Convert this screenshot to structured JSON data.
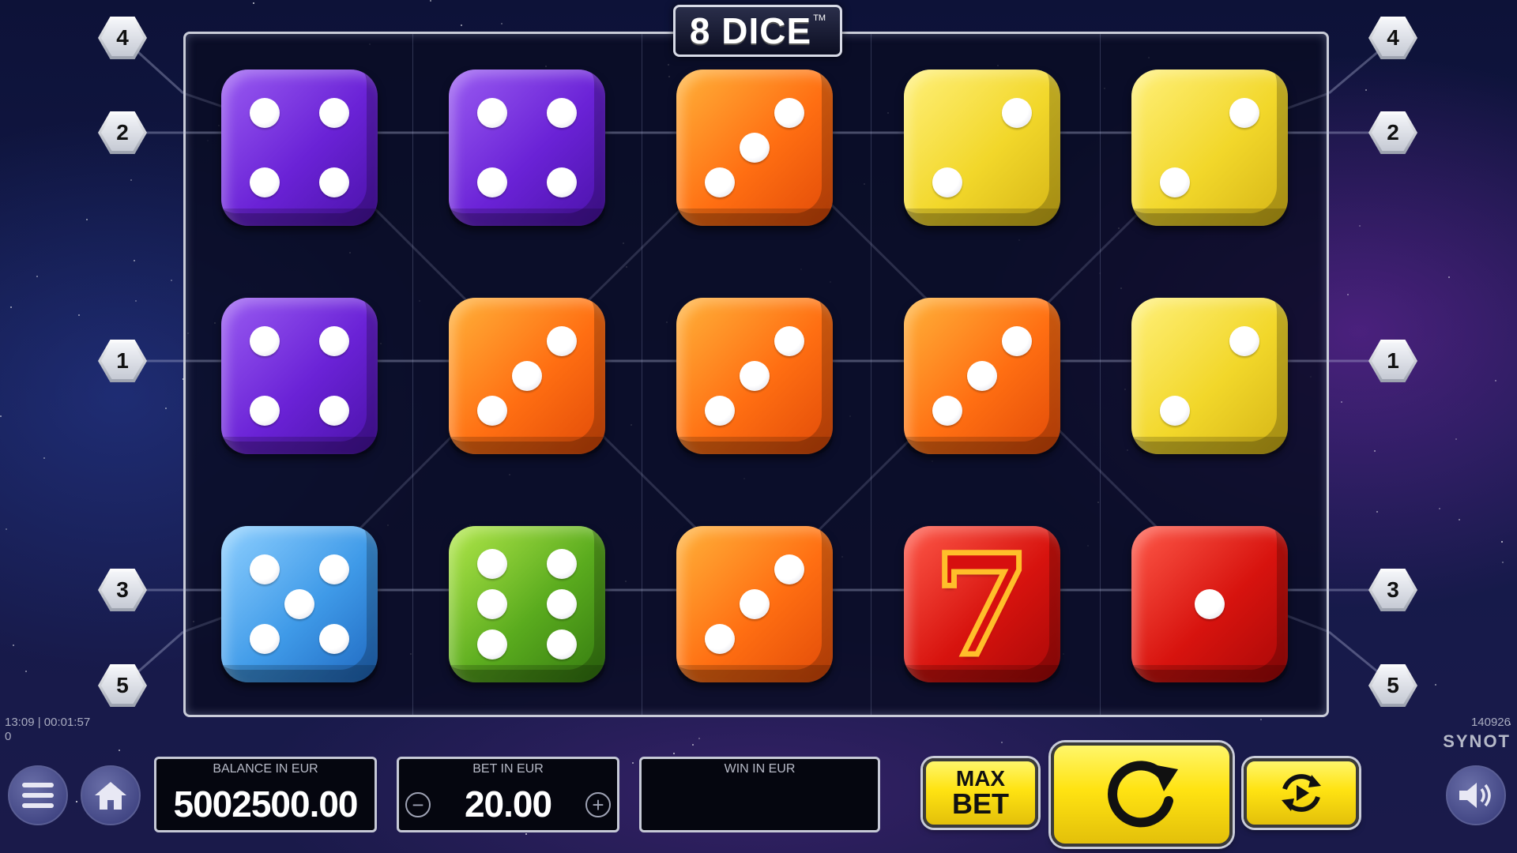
{
  "game": {
    "title": "8 DICE",
    "trademark": "TM"
  },
  "colors": {
    "purple": "#7a36e0",
    "orange": "#ff7a18",
    "yellow": "#f0d52a",
    "blue": "#3f9ae8",
    "green": "#5aab1e",
    "red": "#d7130e",
    "accent": "#ffe312"
  },
  "paylines": {
    "left": [
      "4",
      "2",
      "1",
      "3",
      "5"
    ],
    "right": [
      "4",
      "2",
      "1",
      "3",
      "5"
    ]
  },
  "reels": [
    [
      {
        "color": "purple",
        "face": 4
      },
      {
        "color": "purple",
        "face": 4
      },
      {
        "color": "blue",
        "face": 5
      }
    ],
    [
      {
        "color": "purple",
        "face": 4
      },
      {
        "color": "orange",
        "face": 3
      },
      {
        "color": "green",
        "face": 6
      }
    ],
    [
      {
        "color": "orange",
        "face": 3
      },
      {
        "color": "orange",
        "face": 3
      },
      {
        "color": "orange",
        "face": 3
      }
    ],
    [
      {
        "color": "yellow",
        "face": 2
      },
      {
        "color": "orange",
        "face": 3
      },
      {
        "color": "red",
        "face": "7"
      }
    ],
    [
      {
        "color": "yellow",
        "face": 2
      },
      {
        "color": "yellow",
        "face": 2
      },
      {
        "color": "red",
        "face": 1
      }
    ]
  ],
  "status": {
    "clock": "13:09 | 00:01:57",
    "counter": "0",
    "game_id": "140926",
    "brand": "SYNOT"
  },
  "balance": {
    "label": "BALANCE IN EUR",
    "value": "5002500.00"
  },
  "bet": {
    "label": "BET IN EUR",
    "value": "20.00",
    "minus": "−",
    "plus": "+"
  },
  "win": {
    "label": "WIN IN EUR",
    "value": ""
  },
  "buttons": {
    "max_bet_line1": "MAX",
    "max_bet_line2": "BET",
    "menu_icon": "menu-icon",
    "home_icon": "home-icon",
    "spin_icon": "spin-arrow-icon",
    "autoplay_icon": "autoplay-icon",
    "sound_icon": "speaker-icon"
  }
}
